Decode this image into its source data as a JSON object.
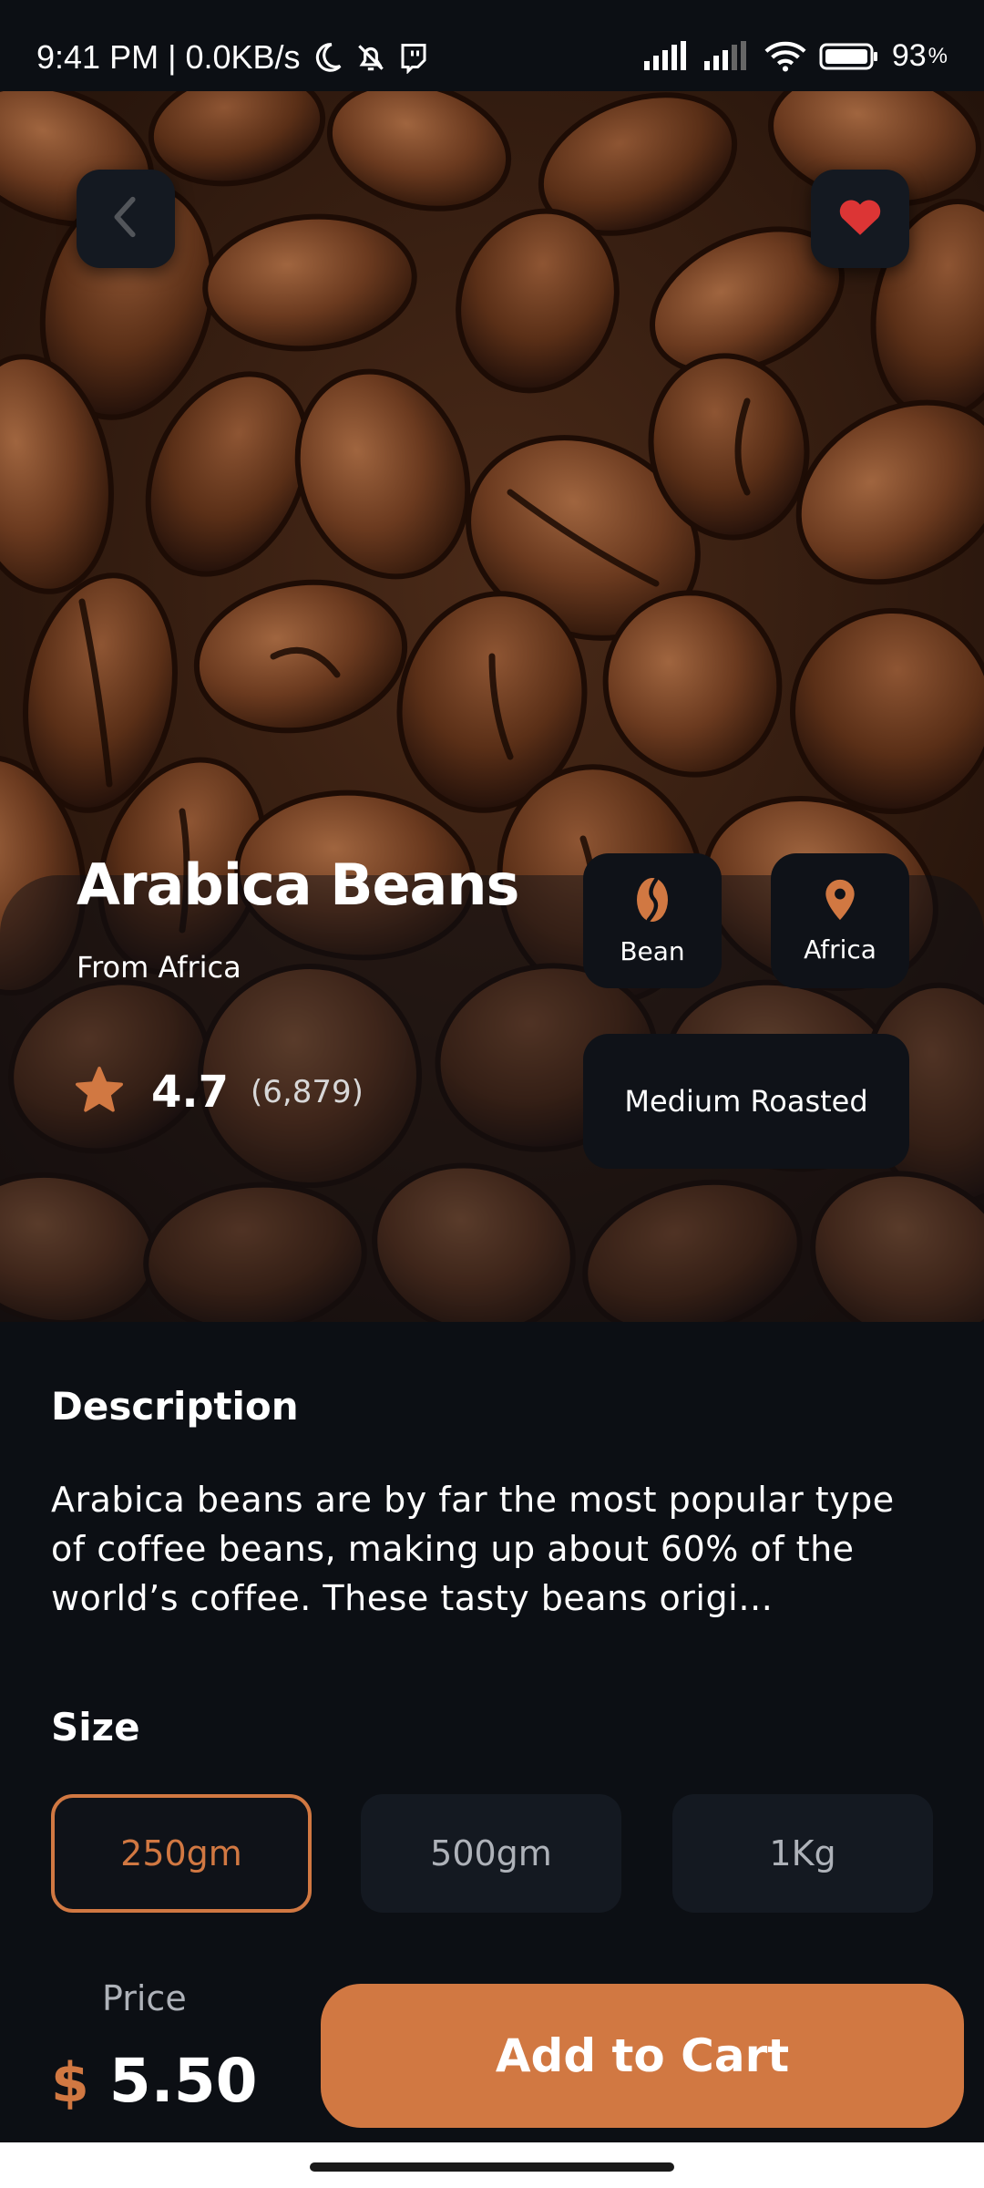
{
  "status_bar": {
    "time": "9:41 PM",
    "separator": "|",
    "network_speed": "0.0KB/s",
    "battery": "93",
    "battery_unit": "%"
  },
  "product": {
    "name": "Arabica Beans",
    "origin": "From Africa",
    "rating": "4.7",
    "rating_count": "(6,879)",
    "type_label": "Bean",
    "location_label": "Africa",
    "roast": "Medium Roasted",
    "favorited": true
  },
  "description": {
    "heading": "Description",
    "text": "Arabica beans are by far the most popular type of coffee beans, making up about 60% of the world’s coffee. These tasty beans origi…"
  },
  "size": {
    "heading": "Size",
    "options": [
      "250gm",
      "500gm",
      "1Kg"
    ],
    "selected": "250gm"
  },
  "price": {
    "label": "Price",
    "currency": "$",
    "value": "5.50"
  },
  "cta": {
    "label": "Add to Cart"
  },
  "colors": {
    "accent": "#d17842",
    "background": "#0c0f14",
    "card": "#141921",
    "favorite": "#dc3535",
    "text_muted": "#aeb2b9"
  },
  "icons": {
    "back": "chevron-left-icon",
    "favorite": "heart-icon",
    "bean": "coffee-bean-icon",
    "location": "location-pin-icon",
    "rating": "star-icon"
  }
}
